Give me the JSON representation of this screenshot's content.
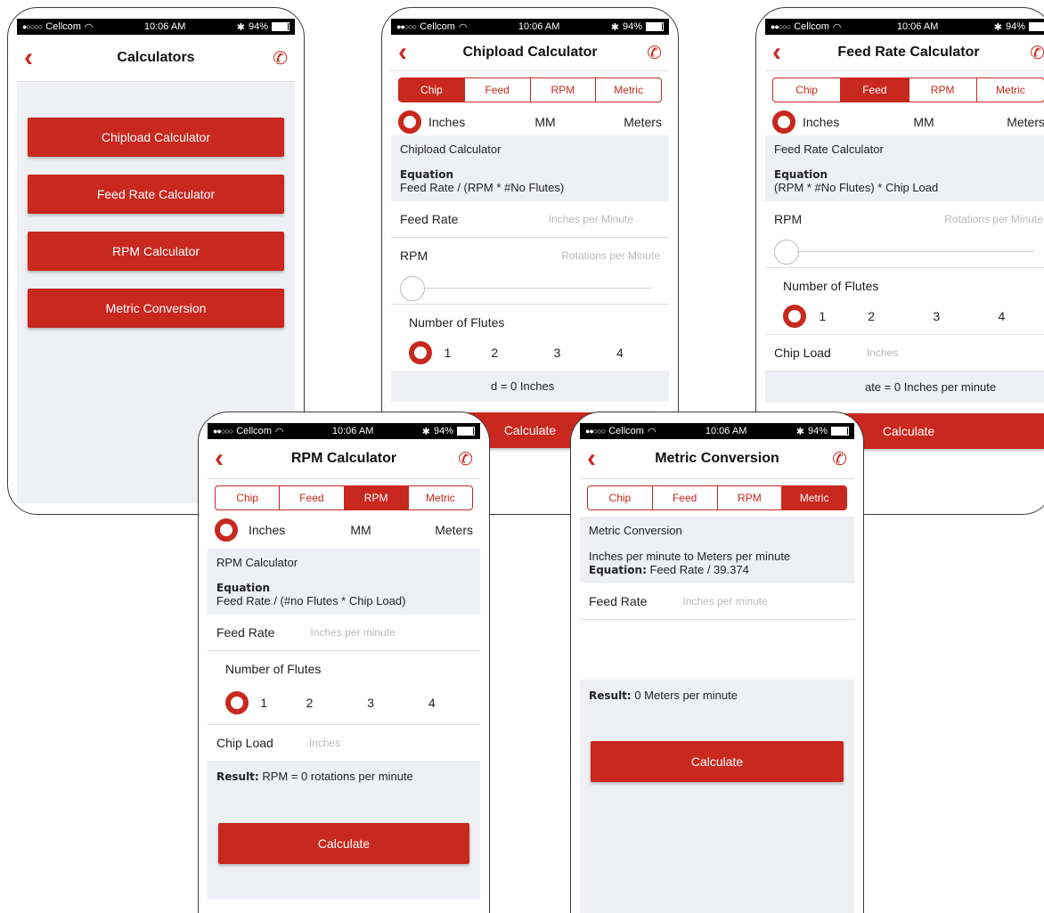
{
  "status": {
    "carrier": "Cellcom",
    "time": "10:06 AM",
    "battery": "94%",
    "wifi_icon": "wifi-icon",
    "bluetooth_icon": "bluetooth-icon"
  },
  "colors": {
    "accent": "#c8281e",
    "background": "#eef0f3"
  },
  "units": [
    "Inches",
    "MM",
    "Meters"
  ],
  "tabs": [
    "Chip",
    "Feed",
    "RPM",
    "Metric"
  ],
  "flutes_label": "Number of Flutes",
  "flutes": [
    "1",
    "2",
    "3",
    "4"
  ],
  "calculate_label": "Calculate",
  "equation_label": "Equation",
  "result_label": "Result:",
  "calculators": {
    "title": "Calculators",
    "buttons": [
      "Chipload Calculator",
      "Feed Rate Calculator",
      "RPM Calculator",
      "Metric Conversion"
    ]
  },
  "chipload": {
    "title": "Chipload Calculator",
    "section_title": "Chipload Calculator",
    "equation": "Feed Rate / (RPM * #No Flutes)",
    "feed_rate_label": "Feed Rate",
    "feed_rate_placeholder": "Inches per Minute",
    "rpm_label": "RPM",
    "rpm_placeholder": "Rotations per Minute",
    "result_partial": "d = 0 Inches"
  },
  "feedrate": {
    "title": "Feed Rate Calculator",
    "section_title": "Feed Rate Calculator",
    "equation": "(RPM * #No Flutes) * Chip Load",
    "rpm_label": "RPM",
    "rpm_placeholder": "Rotations per Minute",
    "chip_load_label": "Chip Load",
    "chip_load_placeholder": "Inches",
    "result_partial": "ate = 0 Inches per minute"
  },
  "rpm": {
    "title": "RPM Calculator",
    "section_title": "RPM Calculator",
    "equation": "Feed Rate / (#no Flutes * Chip Load)",
    "feed_rate_label": "Feed Rate",
    "feed_rate_placeholder": "Inches per minute",
    "chip_load_label": "Chip Load",
    "chip_load_placeholder": "Inches",
    "result": "RPM = 0 rotations per minute"
  },
  "metric": {
    "title": "Metric Conversion",
    "section_title": "Metric Conversion",
    "description": "Inches per minute to Meters per minute",
    "equation_inline_label": "Equation:",
    "equation": "Feed Rate / 39.374",
    "feed_rate_label": "Feed Rate",
    "feed_rate_placeholder": "Inches per minute",
    "result": "0 Meters per minute"
  }
}
